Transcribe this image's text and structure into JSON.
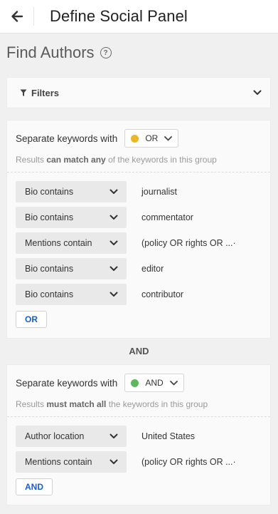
{
  "header": {
    "title": "Define Social Panel"
  },
  "section": {
    "title": "Find Authors"
  },
  "filters": {
    "label": "Filters"
  },
  "groups": [
    {
      "separator_label": "Separate keywords with",
      "operator": "OR",
      "operator_color": "#f0b429",
      "hint_prefix": "Results",
      "hint_bold": "can match any",
      "hint_suffix": "of the keywords in this group",
      "rows": [
        {
          "field": "Bio contains",
          "value": "journalist"
        },
        {
          "field": "Bio contains",
          "value": "commentator"
        },
        {
          "field": "Mentions contain",
          "value": "(policy OR rights OR ...·"
        },
        {
          "field": "Bio contains",
          "value": "editor"
        },
        {
          "field": "Bio contains",
          "value": "contributor"
        }
      ],
      "button": "OR"
    },
    {
      "separator_label": "Separate keywords with",
      "operator": "AND",
      "operator_color": "#5cb85c",
      "hint_prefix": "Results",
      "hint_bold": "must match all",
      "hint_suffix": "the keywords in this group",
      "rows": [
        {
          "field": "Author location",
          "value": "United States"
        },
        {
          "field": "Mentions contain",
          "value": "(policy OR rights OR ...·"
        }
      ],
      "button": "AND"
    }
  ],
  "between_groups": "AND",
  "colors": {
    "link_blue": "#1a5ccf",
    "background": "#f0f0f0"
  }
}
